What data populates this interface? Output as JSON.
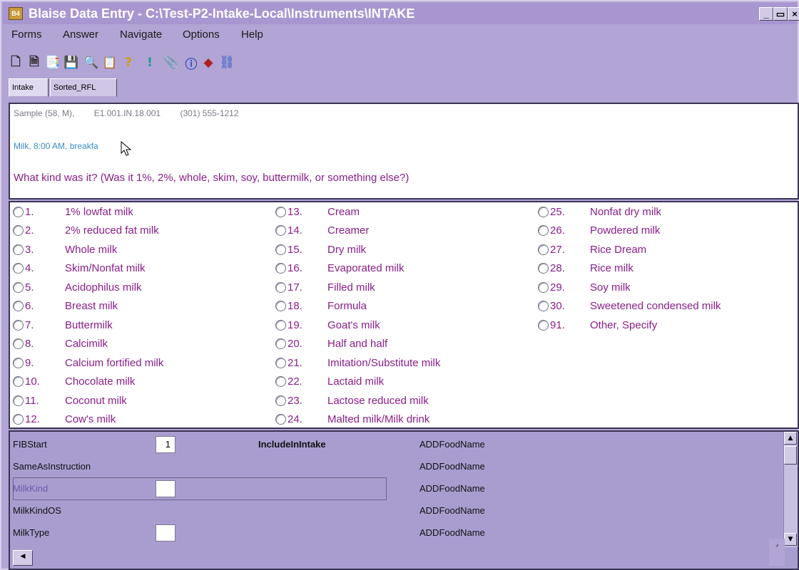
{
  "window": {
    "icon_text": "B4",
    "title": "Blaise Data Entry - C:\\Test-P2-Intake-Local\\Instruments\\INTAKE",
    "minimize": "_",
    "maximize": "▭",
    "close": "×"
  },
  "menu": [
    "Forms",
    "Answer",
    "Navigate",
    "Options",
    "Help"
  ],
  "toolbar": {
    "icons": [
      "new-form-icon",
      "open-form-icon",
      "copy-form-icon",
      "save-icon",
      "find-icon",
      "browse-icon",
      "help-icon",
      "info-icon",
      "attach-icon",
      "about-icon",
      "watch-icon",
      "link-icon"
    ],
    "glyphs": [
      "🗋",
      "🗎",
      "📑",
      "💾",
      "🔍",
      "📋",
      "?",
      "!",
      "📎",
      "ⓘ",
      "◆",
      "⛓"
    ]
  },
  "tabs": [
    {
      "label": "Intake",
      "active": true
    },
    {
      "label": "Sorted_RFL",
      "active": false
    }
  ],
  "question": {
    "sample": [
      "Sample (58, M),",
      "E1.001.IN.18.001",
      "(301) 555-1212"
    ],
    "food": "Milk, 8:00 AM, breakfa",
    "text": "What kind was it? (Was it 1%, 2%, whole, skim, soy, buttermilk, or something else?)"
  },
  "colors": {
    "question": "#8a1e8a",
    "food": "#3a8cc8",
    "window": "#b2a4d4"
  },
  "options": [
    {
      "num": "1.",
      "label": "1% lowfat milk"
    },
    {
      "num": "2.",
      "label": "2% reduced fat milk"
    },
    {
      "num": "3.",
      "label": "Whole milk"
    },
    {
      "num": "4.",
      "label": "Skim/Nonfat milk"
    },
    {
      "num": "5.",
      "label": "Acidophilus milk"
    },
    {
      "num": "6.",
      "label": "Breast milk"
    },
    {
      "num": "7.",
      "label": "Buttermilk"
    },
    {
      "num": "8.",
      "label": "Calcimilk"
    },
    {
      "num": "9.",
      "label": "Calcium fortified milk"
    },
    {
      "num": "10.",
      "label": "Chocolate milk"
    },
    {
      "num": "11.",
      "label": "Coconut milk"
    },
    {
      "num": "12.",
      "label": "Cow's milk"
    },
    {
      "num": "13.",
      "label": "Cream"
    },
    {
      "num": "14.",
      "label": "Creamer"
    },
    {
      "num": "15.",
      "label": "Dry milk"
    },
    {
      "num": "16.",
      "label": "Evaporated milk"
    },
    {
      "num": "17.",
      "label": "Filled milk"
    },
    {
      "num": "18.",
      "label": "Formula"
    },
    {
      "num": "19.",
      "label": "Goat's milk"
    },
    {
      "num": "20.",
      "label": "Half and half"
    },
    {
      "num": "21.",
      "label": "Imitation/Substitute milk"
    },
    {
      "num": "22.",
      "label": "Lactaid milk"
    },
    {
      "num": "23.",
      "label": "Lactose reduced milk"
    },
    {
      "num": "24.",
      "label": "Malted milk/Milk drink"
    },
    {
      "num": "25.",
      "label": "Nonfat dry milk"
    },
    {
      "num": "26.",
      "label": "Powdered milk"
    },
    {
      "num": "27.",
      "label": "Rice Dream"
    },
    {
      "num": "28.",
      "label": "Rice milk"
    },
    {
      "num": "29.",
      "label": "Soy milk"
    },
    {
      "num": "30.",
      "label": "Sweetened condensed milk"
    },
    {
      "num": "91.",
      "label": "Other, Specify"
    }
  ],
  "fields": {
    "include_label": "IncludeInIntake",
    "rows": [
      {
        "name": "FIBStart",
        "value": "1",
        "has_input": true,
        "food": "ADDFoodName"
      },
      {
        "name": "SameAsInstruction",
        "value": "",
        "has_input": false,
        "food": "ADDFoodName"
      },
      {
        "name": "MilkKind",
        "value": "",
        "has_input": true,
        "food": "ADDFoodName",
        "active": true
      },
      {
        "name": "MilkKindOS",
        "value": "",
        "has_input": false,
        "food": "ADDFoodName"
      },
      {
        "name": "MilkType",
        "value": "",
        "has_input": true,
        "food": "ADDFoodName"
      }
    ]
  }
}
